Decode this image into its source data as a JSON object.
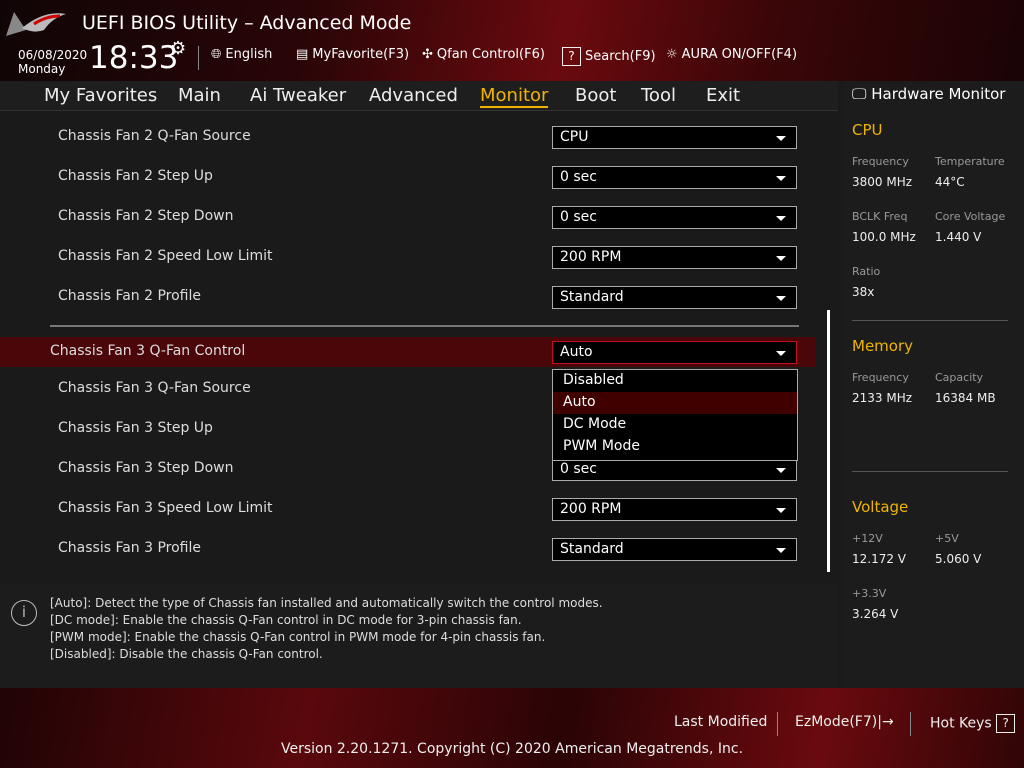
{
  "header": {
    "title": "UEFI BIOS Utility – Advanced Mode",
    "date": "06/08/2020",
    "day": "Monday",
    "time": "18:33",
    "tools": [
      {
        "label": "English",
        "icon": "globe-icon"
      },
      {
        "label": "MyFavorite(F3)",
        "icon": "favorite-list-icon"
      },
      {
        "label": "Qfan Control(F6)",
        "icon": "fan-icon"
      },
      {
        "label": "Search(F9)",
        "icon": "search-help-icon"
      },
      {
        "label": "AURA ON/OFF(F4)",
        "icon": "aura-light-icon"
      }
    ]
  },
  "nav": {
    "tabs": [
      "My Favorites",
      "Main",
      "Ai Tweaker",
      "Advanced",
      "Monitor",
      "Boot",
      "Tool",
      "Exit"
    ],
    "active": "Monitor"
  },
  "settings": [
    {
      "label": "Chassis Fan 2 Q-Fan Source",
      "value": "CPU"
    },
    {
      "label": "Chassis Fan 2 Step Up",
      "value": "0 sec"
    },
    {
      "label": "Chassis Fan 2 Step Down",
      "value": "0 sec"
    },
    {
      "label": "Chassis Fan 2 Speed Low Limit",
      "value": "200 RPM"
    },
    {
      "label": "Chassis Fan 2 Profile",
      "value": "Standard"
    },
    {
      "label": "Chassis Fan 3 Q-Fan Control",
      "value": "Auto"
    },
    {
      "label": "Chassis Fan 3 Q-Fan Source"
    },
    {
      "label": "Chassis Fan 3 Step Up"
    },
    {
      "label": "Chassis Fan 3 Step Down",
      "value": "0 sec"
    },
    {
      "label": "Chassis Fan 3 Speed Low Limit",
      "value": "200 RPM"
    },
    {
      "label": "Chassis Fan 3 Profile",
      "value": "Standard"
    }
  ],
  "dropdown": {
    "options": [
      "Disabled",
      "Auto",
      "DC Mode",
      "PWM Mode"
    ],
    "selected": "Auto"
  },
  "help": [
    "[Auto]: Detect the type of Chassis fan installed and automatically switch the control modes.",
    "[DC mode]: Enable the chassis Q-Fan control in DC mode for 3-pin chassis fan.",
    "[PWM mode]: Enable the chassis Q-Fan control in PWM mode for 4-pin chassis fan.",
    "[Disabled]: Disable the chassis Q-Fan control."
  ],
  "hw": {
    "title": "Hardware Monitor",
    "cpu": {
      "title": "CPU",
      "freq_k": "Frequency",
      "freq": "3800 MHz",
      "temp_k": "Temperature",
      "temp": "44°C",
      "bclk_k": "BCLK Freq",
      "bclk": "100.0 MHz",
      "cv_k": "Core Voltage",
      "cv": "1.440 V",
      "ratio_k": "Ratio",
      "ratio": "38x"
    },
    "mem": {
      "title": "Memory",
      "freq_k": "Frequency",
      "freq": "2133 MHz",
      "cap_k": "Capacity",
      "cap": "16384 MB"
    },
    "volt": {
      "title": "Voltage",
      "v12_k": "+12V",
      "v12": "12.172 V",
      "v5_k": "+5V",
      "v5": "5.060 V",
      "v33_k": "+3.3V",
      "v33": "3.264 V"
    }
  },
  "footer": {
    "last_modified": "Last Modified",
    "ezmode": "EzMode(F7)|",
    "hotkeys": "Hot Keys",
    "hotkeys_icon": "?",
    "version": "Version 2.20.1271. Copyright (C) 2020 American Megatrends, Inc."
  },
  "colors": {
    "accent": "#f0b400",
    "highlight": "#4a0608"
  }
}
